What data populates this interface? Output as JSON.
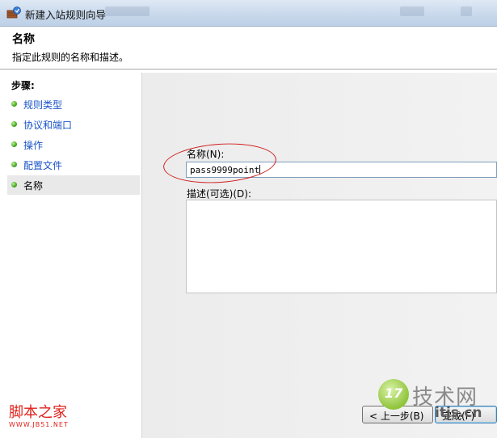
{
  "window": {
    "title": "新建入站规则向导"
  },
  "header": {
    "title": "名称",
    "description": "指定此规则的名称和描述。"
  },
  "steps": {
    "title": "步骤:",
    "items": [
      {
        "label": "规则类型"
      },
      {
        "label": "协议和端口"
      },
      {
        "label": "操作"
      },
      {
        "label": "配置文件"
      },
      {
        "label": "名称"
      }
    ]
  },
  "form": {
    "name_label": "名称(N):",
    "name_value": "pass9999point",
    "description_label": "描述(可选)(D):",
    "description_value": ""
  },
  "buttons": {
    "back": "< 上一步(B)",
    "finish": "完成(F)"
  },
  "watermarks": {
    "left_cn": "脚本之家",
    "left_url": "WWW.JB51.NET",
    "right_num": "17",
    "right_brand": "技术网",
    "right_site": "itjs.cn"
  },
  "colors": {
    "link": "#1a55c8",
    "annotation": "#d11a1a",
    "step_dot": "#3fa11f"
  },
  "icons": {
    "window": "firewall-shield-icon",
    "step": "green-dot-icon"
  }
}
